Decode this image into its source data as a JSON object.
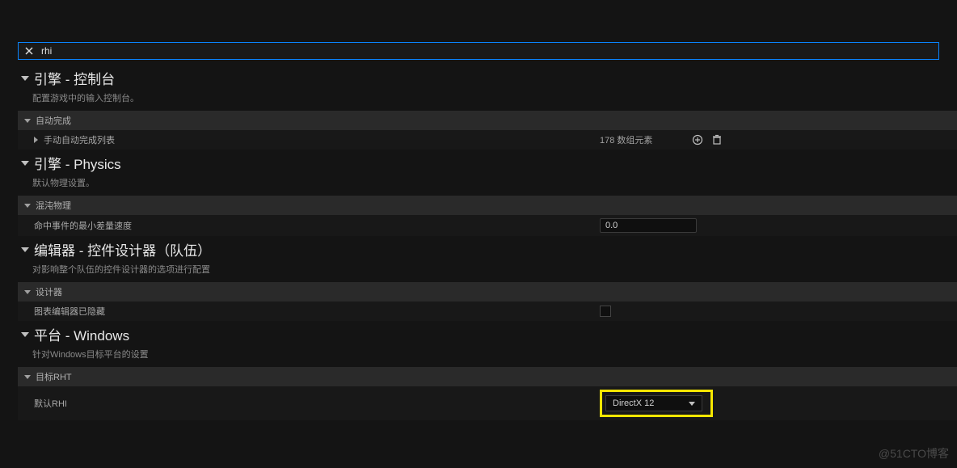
{
  "search": {
    "value": "rhi"
  },
  "sections": {
    "engine_console": {
      "title": "引擎 - 控制台",
      "desc": "配置游戏中的输入控制台。",
      "sub_autocomplete": "自动完成",
      "row_manual": {
        "label": "手动自动完成列表",
        "count": "178 数组元素"
      }
    },
    "engine_physics": {
      "title": "引擎 - Physics",
      "desc": "默认物理设置。",
      "sub_chaos": "混沌物理",
      "row_hit": {
        "label": "命中事件的最小差量速度",
        "value": "0.0"
      }
    },
    "editor_widget": {
      "title": "编辑器 - 控件设计器（队伍）",
      "desc": "对影响整个队伍的控件设计器的选项进行配置",
      "sub_designer": "设计器",
      "row_hidden": {
        "label": "图表编辑器已隐藏"
      }
    },
    "platform_windows": {
      "title": "平台 - Windows",
      "desc": "针对Windows目标平台的设置",
      "sub_rht": "目标RHT",
      "row_rhi": {
        "label": "默认RHI",
        "value": "DirectX 12"
      }
    }
  },
  "watermark": "@51CTO博客"
}
